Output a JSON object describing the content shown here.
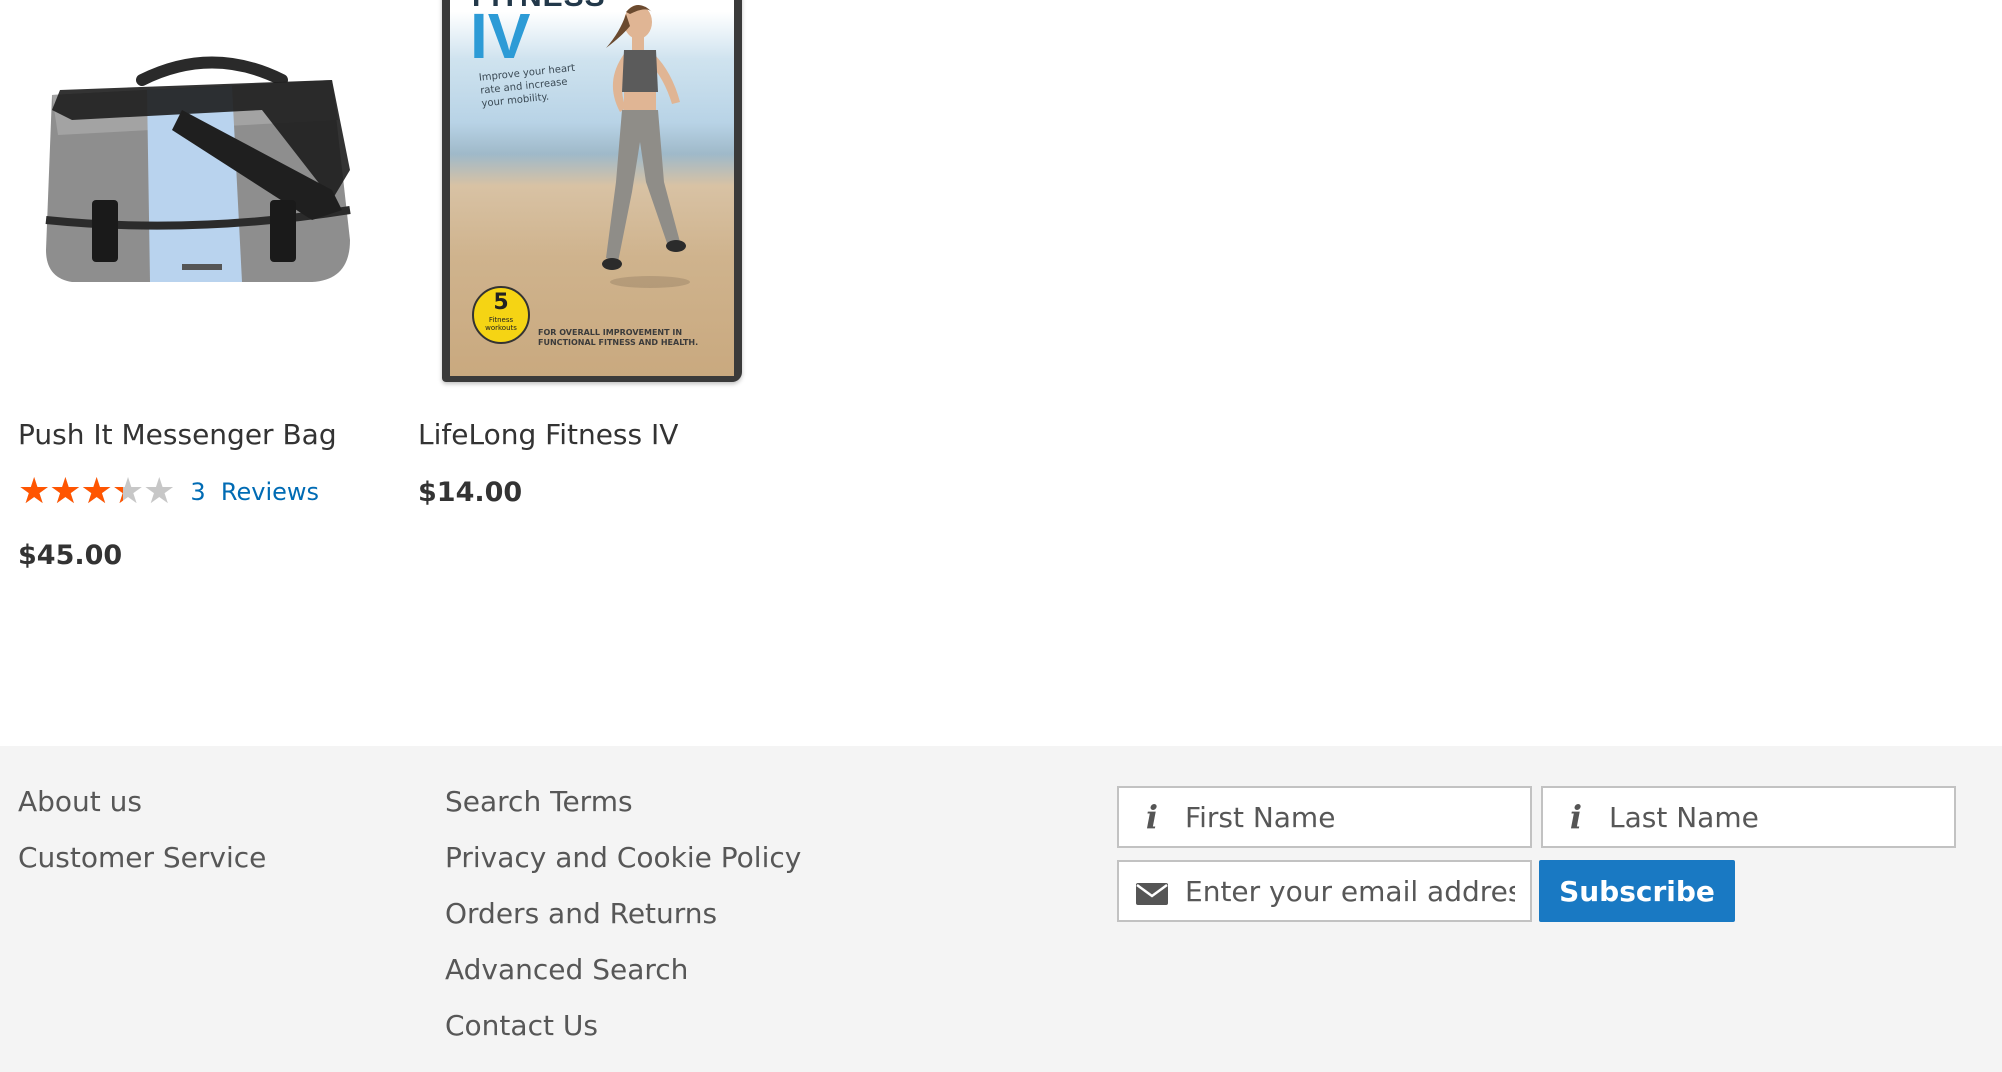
{
  "products": [
    {
      "name": "Push It Messenger Bag",
      "rating_percent": 67,
      "reviews_count": "3",
      "reviews_label": "Reviews",
      "price": "$45.00",
      "image_colors": {
        "body": "#8a8a8a",
        "stripe": "#b9d3ee",
        "strap": "#1f1f1f"
      }
    },
    {
      "name": "LifeLong Fitness IV",
      "price": "$14.00",
      "cover": {
        "title_word": "FITNESS",
        "numeral": "IV",
        "tagline": "Improve your heart rate and increase your mobility.",
        "badge_number": "5",
        "badge_label": "Fitness workouts",
        "footer_text": "FOR OVERALL IMPROVEMENT IN FUNCTIONAL FITNESS AND HEALTH."
      }
    }
  ],
  "stars_glyphs": "★★★★★",
  "footer": {
    "col1": [
      "About us",
      "Customer Service"
    ],
    "col2": [
      "Search Terms",
      "Privacy and Cookie Policy",
      "Orders and Returns",
      "Advanced Search",
      "Contact Us"
    ]
  },
  "newsletter": {
    "first_name_placeholder": "First Name",
    "last_name_placeholder": "Last Name",
    "email_placeholder": "Enter your email address",
    "subscribe_label": "Subscribe",
    "icons": {
      "name_field": "info-icon",
      "email_field": "envelope-icon"
    }
  },
  "colors": {
    "accent": "#1979c3",
    "link": "#006bb4",
    "star": "#ff5501",
    "footer_bg": "#f4f4f4"
  }
}
